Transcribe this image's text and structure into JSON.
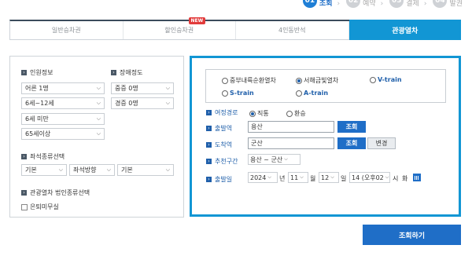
{
  "steps": [
    {
      "num": "01",
      "label": "조회"
    },
    {
      "num": "02",
      "label": "예약"
    },
    {
      "num": "03",
      "label": "결제"
    },
    {
      "num": "04",
      "label": "발권"
    }
  ],
  "tabs": [
    {
      "label": "일반승차권"
    },
    {
      "label": "할인승차권",
      "badge": "NEW"
    },
    {
      "label": "4인동반석"
    },
    {
      "label": "관광열차"
    }
  ],
  "passenger": {
    "title": "인원정보",
    "adult": "어른 1명",
    "child": "6세~12세",
    "infant": "6세 미만",
    "senior": "65세이상"
  },
  "disability": {
    "title": "장애정도",
    "severe": "중증 0명",
    "mild": "경증 0명"
  },
  "seat": {
    "title": "좌석종류선택",
    "type": "기본",
    "direction": "좌석방향",
    "position": "기본"
  },
  "legal": {
    "title": "관광열차 법인종류선택",
    "checkbox": "은퇴미무실"
  },
  "trains": {
    "o_train": "중부내륙순환열차",
    "west_train": "서해금빛열차",
    "v_train": "V-train",
    "s_train": "S-train",
    "a_train": "A-train"
  },
  "form": {
    "route_label": "여정경로",
    "route_direct": "직통",
    "route_transfer": "환승",
    "departure_label": "출발역",
    "departure_value": "용산",
    "arrival_label": "도착역",
    "arrival_value": "군산",
    "lookup": "조회",
    "swap": "변경",
    "section_label": "추천구간",
    "section_value": "용산 ~ 군산",
    "date_label": "출발일",
    "year": "2024",
    "year_unit": "년",
    "month": "11",
    "month_unit": "월",
    "day": "12",
    "day_unit": "일",
    "hour": "14 (오후02",
    "hour_unit": "시",
    "day_of_week": "화"
  },
  "submit": "조회하기"
}
